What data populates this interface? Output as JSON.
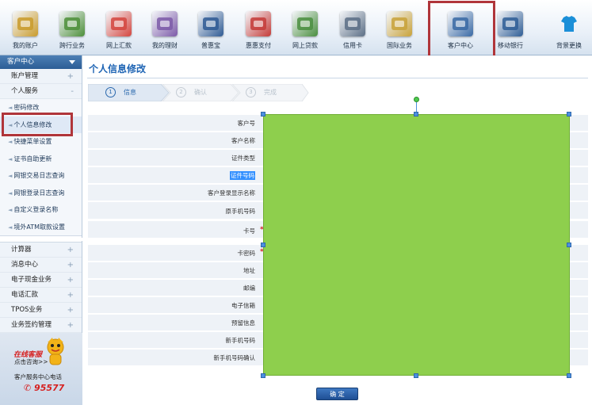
{
  "toolbar": {
    "items": [
      {
        "label": "我的账户",
        "icon": "account-icon"
      },
      {
        "label": "跨行业务",
        "icon": "interbank-icon"
      },
      {
        "label": "网上汇款",
        "icon": "remittance-icon"
      },
      {
        "label": "我的理财",
        "icon": "finance-icon"
      },
      {
        "label": "普惠宝",
        "icon": "puhuibao-icon"
      },
      {
        "label": "惠惠支付",
        "icon": "payment-icon"
      },
      {
        "label": "网上贷款",
        "icon": "loan-icon"
      },
      {
        "label": "信用卡",
        "icon": "credit-card-icon"
      },
      {
        "label": "国际业务",
        "icon": "international-icon"
      },
      {
        "label": "客户中心",
        "icon": "customer-center-icon"
      },
      {
        "label": "移动银行",
        "icon": "mobile-bank-icon"
      },
      {
        "label": "背景更换",
        "icon": "tshirt-icon"
      }
    ]
  },
  "sidebar": {
    "header": "客户中心",
    "groups_top": [
      {
        "label": "账户管理",
        "mark": "+"
      },
      {
        "label": "个人服务",
        "mark": "-"
      }
    ],
    "subitems": [
      "密码修改",
      "个人信息修改",
      "快捷菜单设置",
      "证书自助更新",
      "网银交易日志查询",
      "网银登录日志查询",
      "自定义登录名称",
      "境外ATM取款设置"
    ],
    "groups_bottom": [
      {
        "label": "计算器",
        "mark": "+"
      },
      {
        "label": "消息中心",
        "mark": "+"
      },
      {
        "label": "电子现金业务",
        "mark": "+"
      },
      {
        "label": "电话汇款",
        "mark": "+"
      },
      {
        "label": "TPOS业务",
        "mark": "+"
      },
      {
        "label": "业务签约管理",
        "mark": "+"
      }
    ],
    "banner": {
      "line1": "在线客服",
      "line2": "点击咨询>>",
      "line3": "客户服务中心电话",
      "phone": "95577"
    }
  },
  "main": {
    "title": "个人信息修改",
    "steps": [
      {
        "num": "1",
        "label": "信息",
        "active": true
      },
      {
        "num": "2",
        "label": "确认",
        "active": false
      },
      {
        "num": "3",
        "label": "完成",
        "active": false
      }
    ],
    "fields": [
      {
        "label": "客户号",
        "required": false
      },
      {
        "label": "客户名称",
        "required": false
      },
      {
        "label": "证件类型",
        "required": false
      },
      {
        "label": "证件号码",
        "required": false,
        "selected": true
      },
      {
        "label": "客户登录显示名称",
        "required": false
      },
      {
        "label": "原手机号码",
        "required": false
      },
      {
        "label": "卡号",
        "required": true
      },
      {
        "label": "卡密码",
        "required": true
      },
      {
        "label": "地址",
        "required": false
      },
      {
        "label": "邮编",
        "required": false
      },
      {
        "label": "电子信箱",
        "required": false
      },
      {
        "label": "预留信息",
        "required": false
      },
      {
        "label": "新手机号码",
        "required": false
      },
      {
        "label": "新手机号码确认",
        "required": false
      }
    ],
    "confirm_label": "确 定"
  },
  "colors": {
    "accent": "#1e64b4",
    "highlight_border": "#b0353a",
    "overlay_fill": "#8ecf4d",
    "required": "#d21d1d"
  }
}
